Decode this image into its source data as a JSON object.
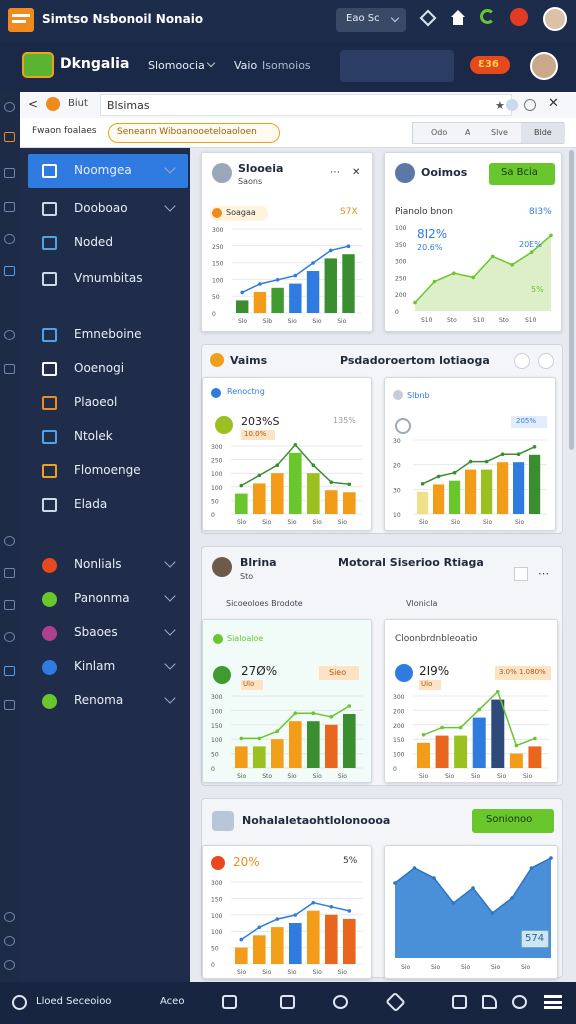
{
  "title_bar": {
    "title": "Simtso Nsbonoil Nonaio",
    "search_box": "Eao   Sc"
  },
  "app_header": {
    "brand": "Dkngalia",
    "menu_1": "Slomoocia",
    "menu_2": "Vaio",
    "menu_3": "Isomoios",
    "badge": "Ɛ36"
  },
  "tab_bar": {
    "back": "<",
    "tab_label": "Biut",
    "address": "Blsimas"
  },
  "filter_row": {
    "label": "Fwaon foalaes",
    "chip": "Seneann Wiboanooeteloaoloen",
    "tabs": [
      "Odo",
      "A",
      "Slve",
      "Blde"
    ]
  },
  "sidebar": {
    "items": [
      {
        "label": "Noomgea",
        "icon": "grid-icon",
        "active": true,
        "chevron": true
      },
      {
        "label": "Dooboao",
        "icon": "doc-icon",
        "chevron": true
      },
      {
        "label": "Noded",
        "icon": "nodes-icon"
      },
      {
        "label": "Vmumbitas",
        "icon": "list-icon"
      },
      {
        "label": "Emneboine",
        "icon": "box-icon"
      },
      {
        "label": "Ooenogi",
        "icon": "folder-icon"
      },
      {
        "label": "Plaoeol",
        "icon": "orange-doc-icon"
      },
      {
        "label": "Ntolek",
        "icon": "table-icon"
      },
      {
        "label": "Flomoenge",
        "icon": "gear-icon"
      },
      {
        "label": "Elada",
        "icon": "list-icon"
      },
      {
        "label": "Nonlials",
        "icon": "flag-icon",
        "chevron": true
      },
      {
        "label": "Panonma",
        "icon": "globe-icon",
        "chevron": true
      },
      {
        "label": "Sbaoes",
        "icon": "pin-icon",
        "chevron": true
      },
      {
        "label": "Kinlam",
        "icon": "moon-icon",
        "chevron": true
      },
      {
        "label": "Renoma",
        "icon": "leaf-icon",
        "chevron": true
      }
    ]
  },
  "section_1": {
    "card_a": {
      "title": "Slooeia",
      "subtitle": "Saons",
      "badge": "Soagaa",
      "pct": "S7X",
      "y_ticks": [
        "300",
        "250",
        "150",
        "100",
        "50",
        "0"
      ],
      "x_ticks": [
        "Slo",
        "Sib",
        "Sio",
        "Sio",
        "Sio"
      ]
    },
    "card_b": {
      "title": "Ooimos",
      "button": "Sa Bcia",
      "chart_title": "Pianolo bnon",
      "big": "8I2%",
      "sub": "20.6%",
      "pct_top": "8I3%",
      "pct_mid": "20E%",
      "pct_low": "5%",
      "y_ticks": [
        "100",
        "350",
        "300",
        "250",
        "200",
        "0"
      ],
      "x_ticks": [
        "S10",
        "Sto",
        "S10",
        "Sto",
        "S10"
      ]
    }
  },
  "section_2": {
    "title_left": "Vaims",
    "title_right": "Psdadoroertom lotiaoga",
    "card_a": {
      "badge": "Renoctng",
      "big": "203%S",
      "tag": "10.0%",
      "pct": "135%",
      "y_ticks": [
        "300",
        "250",
        "100",
        "100",
        "50",
        "0"
      ],
      "x_ticks": [
        "Slo",
        "Sio",
        "Sio",
        "Sio",
        "Sio"
      ]
    },
    "card_b": {
      "badge": "Slbnb",
      "pct": "205%",
      "y_ticks": [
        "30",
        "20",
        "30",
        "10"
      ],
      "x_ticks": [
        "Sio",
        "Sio",
        "Sio",
        "Sio"
      ]
    }
  },
  "section_3": {
    "title_left": "Blrina",
    "subtitle_left": "Sto",
    "title_right": "Motoral Siserioo Rtiaga",
    "sub_left": "Sicoeoloes Brodote",
    "sub_right": "Vlonicla",
    "card_a": {
      "badge": "Sialoaloe",
      "big": "27Ø%",
      "sub": "Ulo",
      "tag": "Sieo",
      "y_ticks": [
        "300",
        "100",
        "150",
        "100",
        "50",
        "0"
      ],
      "x_ticks": [
        "Sio",
        "Sto",
        "Sio",
        "Sio",
        "Sio"
      ]
    },
    "card_b": {
      "title": "Cloonbrdnbleoatio",
      "big": "2I9%",
      "sub": "Ulo",
      "tag": "3.0%",
      "tag2": "1.080%",
      "y_ticks": [
        "300",
        "200",
        "200",
        "150",
        "100",
        "0"
      ],
      "x_ticks": [
        "Sio",
        "Sio",
        "Sio",
        "Sio",
        "Sio"
      ]
    }
  },
  "section_4": {
    "title": "Nohalaletaohtlolonoooa",
    "button": "Sonionoo",
    "card_a": {
      "big": "20%",
      "pct": "5%",
      "y_ticks": [
        "300",
        "150",
        "100",
        "100",
        "50",
        "0"
      ],
      "x_ticks": [
        "Sio",
        "Sio",
        "Sio",
        "Sio",
        "Sio"
      ]
    },
    "card_b": {
      "tag": "574",
      "x_ticks": [
        "Sio",
        "Sio",
        "Sio",
        "Sio",
        "Sio"
      ]
    }
  },
  "bottom_bar": {
    "left_label": "Lloed Seceoioo",
    "mid_label": "Aceo"
  },
  "colors": {
    "accent": "#2f7be0",
    "green": "#6ac62d",
    "orange": "#f39c1a",
    "navy": "#1d2c4b"
  }
}
